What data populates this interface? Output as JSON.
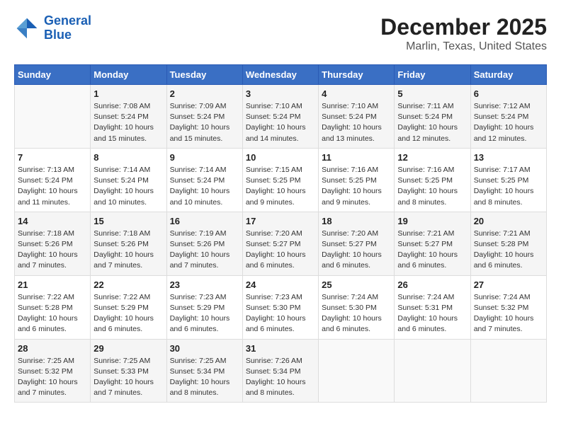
{
  "header": {
    "logo_line1": "General",
    "logo_line2": "Blue",
    "title": "December 2025",
    "subtitle": "Marlin, Texas, United States"
  },
  "days_of_week": [
    "Sunday",
    "Monday",
    "Tuesday",
    "Wednesday",
    "Thursday",
    "Friday",
    "Saturday"
  ],
  "weeks": [
    [
      {
        "day": "",
        "info": ""
      },
      {
        "day": "1",
        "info": "Sunrise: 7:08 AM\nSunset: 5:24 PM\nDaylight: 10 hours\nand 15 minutes."
      },
      {
        "day": "2",
        "info": "Sunrise: 7:09 AM\nSunset: 5:24 PM\nDaylight: 10 hours\nand 15 minutes."
      },
      {
        "day": "3",
        "info": "Sunrise: 7:10 AM\nSunset: 5:24 PM\nDaylight: 10 hours\nand 14 minutes."
      },
      {
        "day": "4",
        "info": "Sunrise: 7:10 AM\nSunset: 5:24 PM\nDaylight: 10 hours\nand 13 minutes."
      },
      {
        "day": "5",
        "info": "Sunrise: 7:11 AM\nSunset: 5:24 PM\nDaylight: 10 hours\nand 12 minutes."
      },
      {
        "day": "6",
        "info": "Sunrise: 7:12 AM\nSunset: 5:24 PM\nDaylight: 10 hours\nand 12 minutes."
      }
    ],
    [
      {
        "day": "7",
        "info": "Sunrise: 7:13 AM\nSunset: 5:24 PM\nDaylight: 10 hours\nand 11 minutes."
      },
      {
        "day": "8",
        "info": "Sunrise: 7:14 AM\nSunset: 5:24 PM\nDaylight: 10 hours\nand 10 minutes."
      },
      {
        "day": "9",
        "info": "Sunrise: 7:14 AM\nSunset: 5:24 PM\nDaylight: 10 hours\nand 10 minutes."
      },
      {
        "day": "10",
        "info": "Sunrise: 7:15 AM\nSunset: 5:25 PM\nDaylight: 10 hours\nand 9 minutes."
      },
      {
        "day": "11",
        "info": "Sunrise: 7:16 AM\nSunset: 5:25 PM\nDaylight: 10 hours\nand 9 minutes."
      },
      {
        "day": "12",
        "info": "Sunrise: 7:16 AM\nSunset: 5:25 PM\nDaylight: 10 hours\nand 8 minutes."
      },
      {
        "day": "13",
        "info": "Sunrise: 7:17 AM\nSunset: 5:25 PM\nDaylight: 10 hours\nand 8 minutes."
      }
    ],
    [
      {
        "day": "14",
        "info": "Sunrise: 7:18 AM\nSunset: 5:26 PM\nDaylight: 10 hours\nand 7 minutes."
      },
      {
        "day": "15",
        "info": "Sunrise: 7:18 AM\nSunset: 5:26 PM\nDaylight: 10 hours\nand 7 minutes."
      },
      {
        "day": "16",
        "info": "Sunrise: 7:19 AM\nSunset: 5:26 PM\nDaylight: 10 hours\nand 7 minutes."
      },
      {
        "day": "17",
        "info": "Sunrise: 7:20 AM\nSunset: 5:27 PM\nDaylight: 10 hours\nand 6 minutes."
      },
      {
        "day": "18",
        "info": "Sunrise: 7:20 AM\nSunset: 5:27 PM\nDaylight: 10 hours\nand 6 minutes."
      },
      {
        "day": "19",
        "info": "Sunrise: 7:21 AM\nSunset: 5:27 PM\nDaylight: 10 hours\nand 6 minutes."
      },
      {
        "day": "20",
        "info": "Sunrise: 7:21 AM\nSunset: 5:28 PM\nDaylight: 10 hours\nand 6 minutes."
      }
    ],
    [
      {
        "day": "21",
        "info": "Sunrise: 7:22 AM\nSunset: 5:28 PM\nDaylight: 10 hours\nand 6 minutes."
      },
      {
        "day": "22",
        "info": "Sunrise: 7:22 AM\nSunset: 5:29 PM\nDaylight: 10 hours\nand 6 minutes."
      },
      {
        "day": "23",
        "info": "Sunrise: 7:23 AM\nSunset: 5:29 PM\nDaylight: 10 hours\nand 6 minutes."
      },
      {
        "day": "24",
        "info": "Sunrise: 7:23 AM\nSunset: 5:30 PM\nDaylight: 10 hours\nand 6 minutes."
      },
      {
        "day": "25",
        "info": "Sunrise: 7:24 AM\nSunset: 5:30 PM\nDaylight: 10 hours\nand 6 minutes."
      },
      {
        "day": "26",
        "info": "Sunrise: 7:24 AM\nSunset: 5:31 PM\nDaylight: 10 hours\nand 6 minutes."
      },
      {
        "day": "27",
        "info": "Sunrise: 7:24 AM\nSunset: 5:32 PM\nDaylight: 10 hours\nand 7 minutes."
      }
    ],
    [
      {
        "day": "28",
        "info": "Sunrise: 7:25 AM\nSunset: 5:32 PM\nDaylight: 10 hours\nand 7 minutes."
      },
      {
        "day": "29",
        "info": "Sunrise: 7:25 AM\nSunset: 5:33 PM\nDaylight: 10 hours\nand 7 minutes."
      },
      {
        "day": "30",
        "info": "Sunrise: 7:25 AM\nSunset: 5:34 PM\nDaylight: 10 hours\nand 8 minutes."
      },
      {
        "day": "31",
        "info": "Sunrise: 7:26 AM\nSunset: 5:34 PM\nDaylight: 10 hours\nand 8 minutes."
      },
      {
        "day": "",
        "info": ""
      },
      {
        "day": "",
        "info": ""
      },
      {
        "day": "",
        "info": ""
      }
    ]
  ]
}
